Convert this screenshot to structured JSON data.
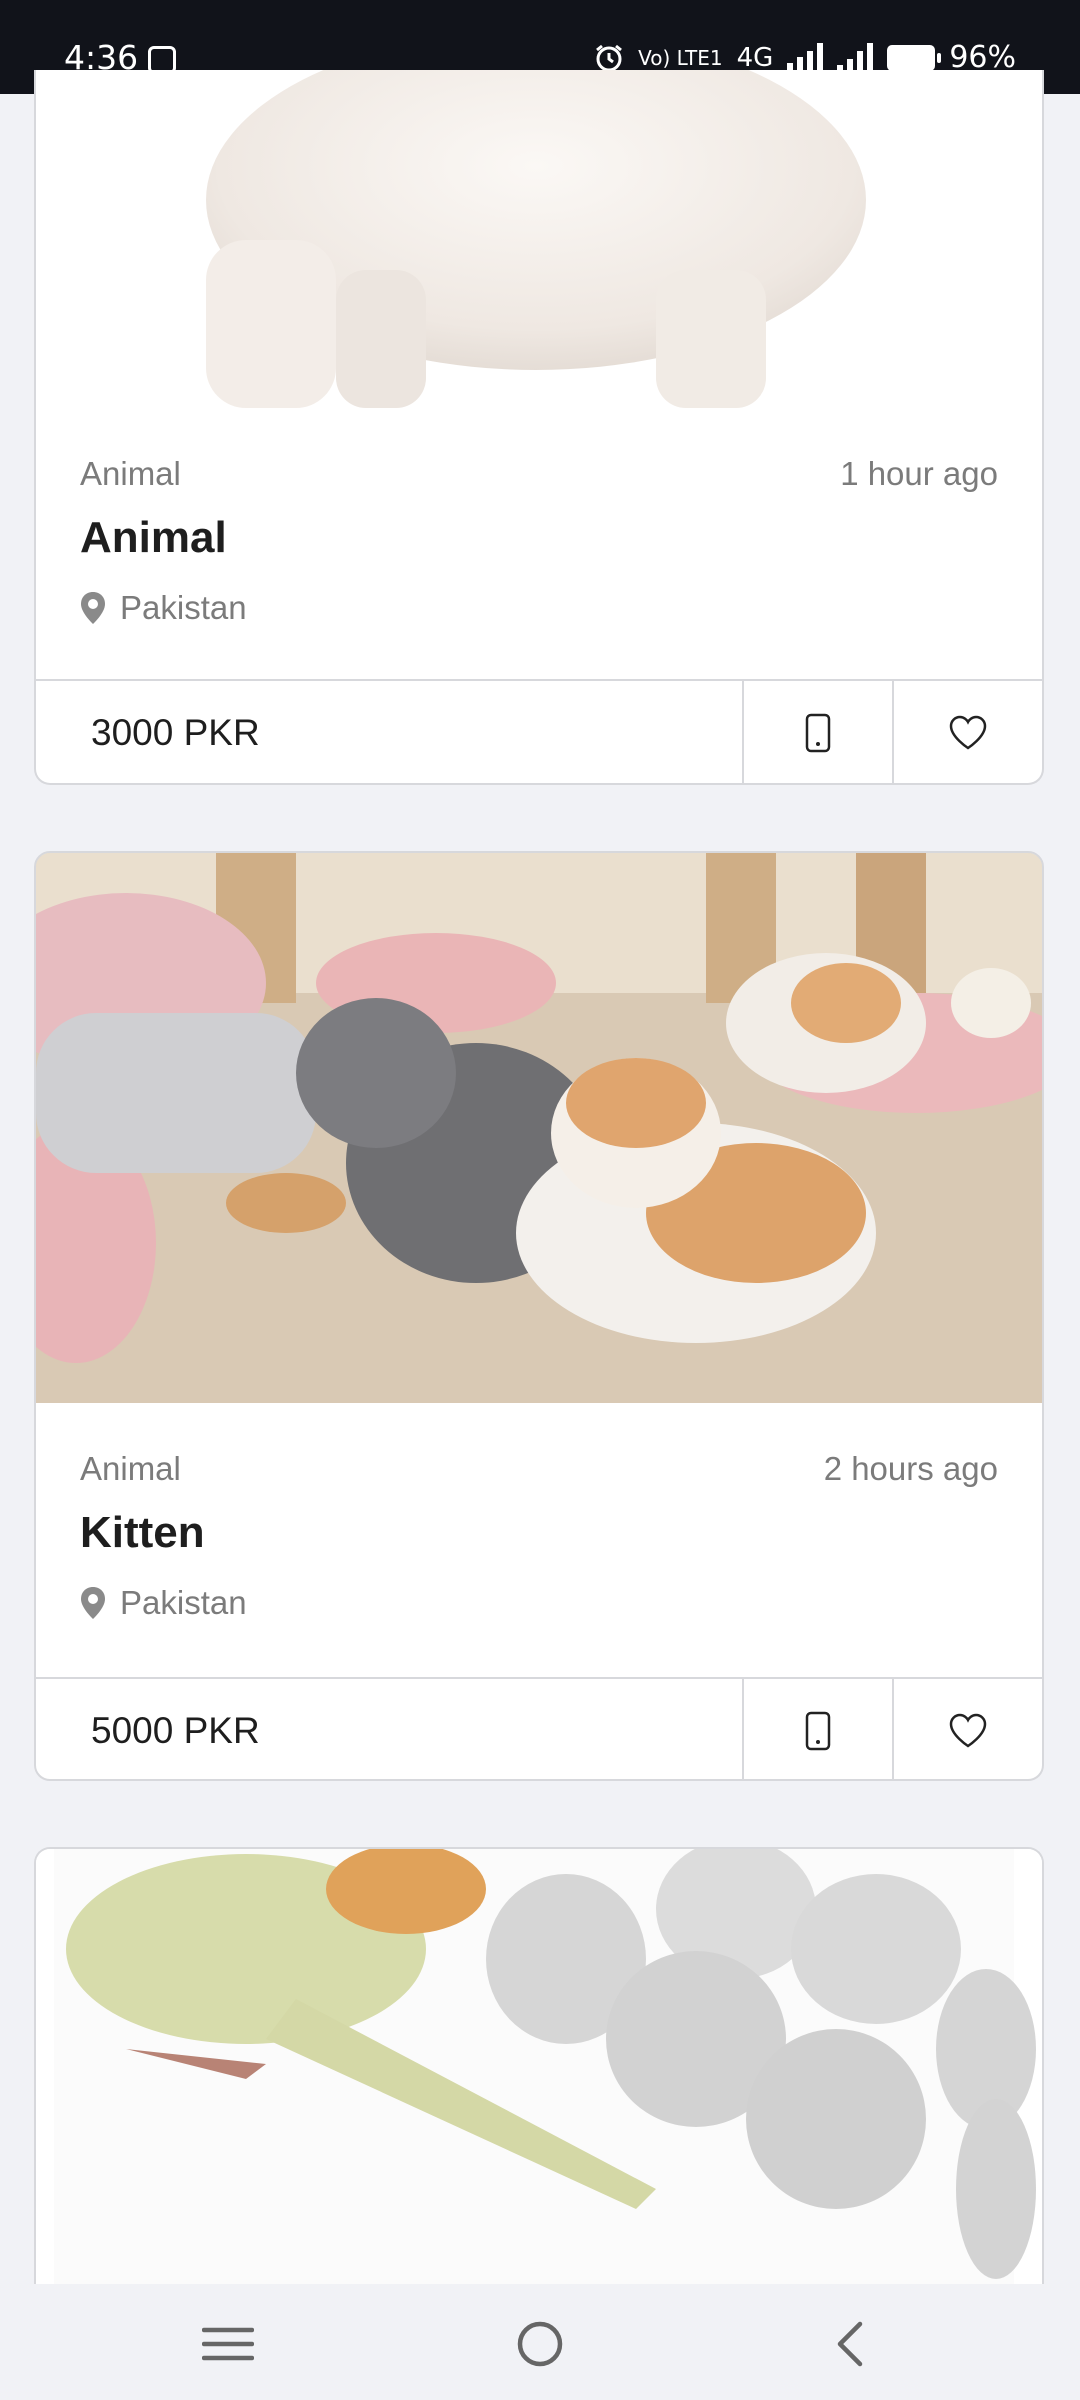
{
  "status_bar": {
    "time": "4:36",
    "network": "4G",
    "volte": "Vo) LTE1",
    "battery": "96%"
  },
  "listings": [
    {
      "image": "white-animal-photo",
      "category": "Animal",
      "time": "1 hour ago",
      "title": "Animal",
      "location": "Pakistan",
      "price": "3000 PKR"
    },
    {
      "image": "kittens-playing-photo",
      "category": "Animal",
      "time": "2 hours ago",
      "title": "Kitten",
      "location": "Pakistan",
      "price": "5000 PKR"
    },
    {
      "image": "parrot-and-eggs-photo"
    }
  ],
  "nav_bar": {
    "icons": [
      "menu-icon",
      "home-icon",
      "back-icon"
    ]
  },
  "colors": {
    "background": "#f1f2f6",
    "card": "#ffffff",
    "border": "#d7d8dc",
    "text_primary": "#1e1e1e",
    "text_secondary": "#7b7b7b",
    "status_bar": "#11131a"
  }
}
